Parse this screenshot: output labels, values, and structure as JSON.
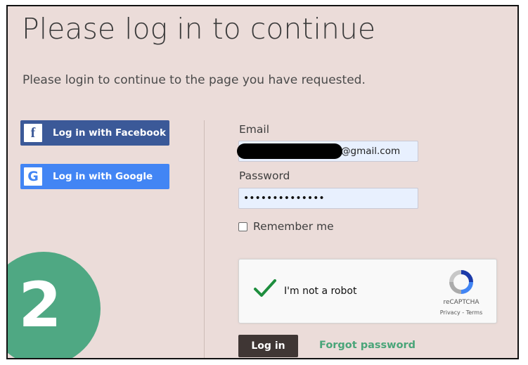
{
  "page": {
    "title": "Please log in to continue",
    "subtitle": "Please login to continue to the page you have requested."
  },
  "social": {
    "facebook_label": "Log in with Facebook",
    "facebook_glyph": "f",
    "google_label": "Log in with Google",
    "google_glyph": "G"
  },
  "form": {
    "email_label": "Email",
    "email_value_visible": "@gmail.com",
    "password_label": "Password",
    "password_mask": "••••••••••••••",
    "remember_label": "Remember me",
    "remember_checked": false,
    "login_button": "Log in",
    "forgot_link": "Forgot password"
  },
  "captcha": {
    "label": "I'm not a robot",
    "brand": "reCAPTCHA",
    "links": "Privacy - Terms",
    "checked": true,
    "check_color": "#1e8e3e"
  },
  "badge": {
    "number": "2",
    "color": "#4fa883"
  },
  "colors": {
    "background": "#ebdcd9",
    "facebook": "#3b5998",
    "google": "#4285f4",
    "login_button": "#3f3634",
    "forgot_link": "#4aa579"
  }
}
